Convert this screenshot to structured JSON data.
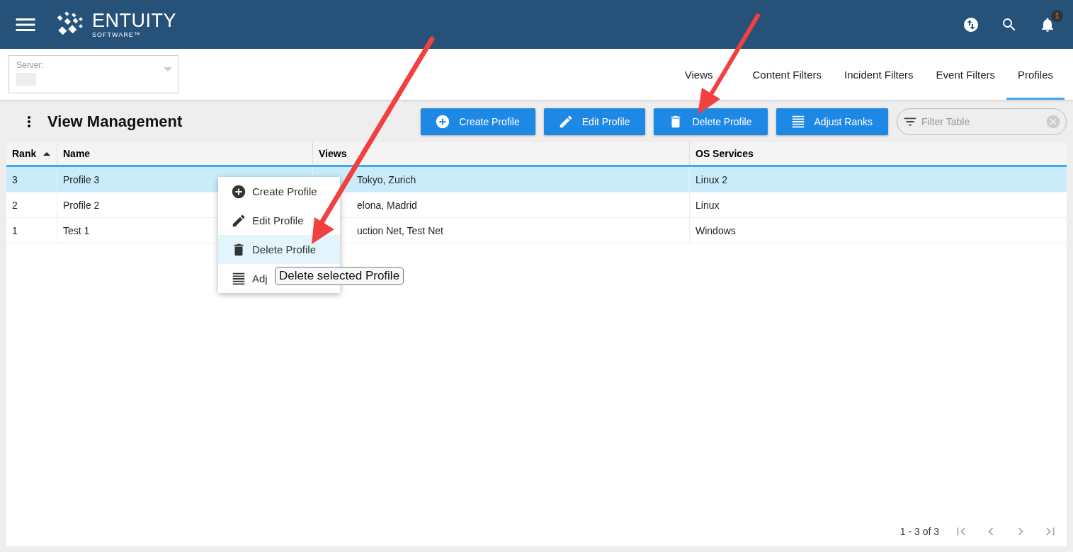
{
  "header": {
    "logo_name": "ENTUITY",
    "logo_sub": "SOFTWARE™",
    "notification_count": "1"
  },
  "server": {
    "label": "Server:"
  },
  "tabs": [
    {
      "label": "Views",
      "selected": false
    },
    {
      "label": "Content Filters",
      "selected": false
    },
    {
      "label": "Incident Filters",
      "selected": false
    },
    {
      "label": "Event Filters",
      "selected": false
    },
    {
      "label": "Profiles",
      "selected": true
    }
  ],
  "page_title": "View Management",
  "toolbar_buttons": [
    {
      "kind": "create",
      "label": "Create Profile"
    },
    {
      "kind": "edit",
      "label": "Edit Profile"
    },
    {
      "kind": "delete",
      "label": "Delete Profile"
    },
    {
      "kind": "ranks",
      "label": "Adjust Ranks"
    }
  ],
  "filter": {
    "placeholder": "Filter Table"
  },
  "table": {
    "columns": [
      {
        "label": "Rank",
        "sorted": true
      },
      {
        "label": "Name",
        "sorted": false
      },
      {
        "label": "Views",
        "sorted": false
      },
      {
        "label": "OS Services",
        "sorted": false
      }
    ],
    "rows": [
      {
        "cells": [
          "3",
          "Profile 3",
          "Tokyo, Zurich",
          "Linux 2"
        ],
        "selected": true
      },
      {
        "cells": [
          "2",
          "Profile 2",
          "elona, Madrid",
          "Linux"
        ],
        "selected": false
      },
      {
        "cells": [
          "1",
          "Test 1",
          "uction Net, Test Net",
          "Windows"
        ],
        "selected": false
      }
    ]
  },
  "context_menu": [
    {
      "kind": "create",
      "label": "Create Profile",
      "hovered": false
    },
    {
      "kind": "edit",
      "label": "Edit Profile",
      "hovered": false
    },
    {
      "kind": "delete",
      "label": "Delete Profile",
      "hovered": true
    },
    {
      "kind": "ranks",
      "label": "Adj",
      "hovered": false
    }
  ],
  "tooltip": "Delete selected Profile",
  "pagination": {
    "range": "1 - 3 of 3"
  }
}
